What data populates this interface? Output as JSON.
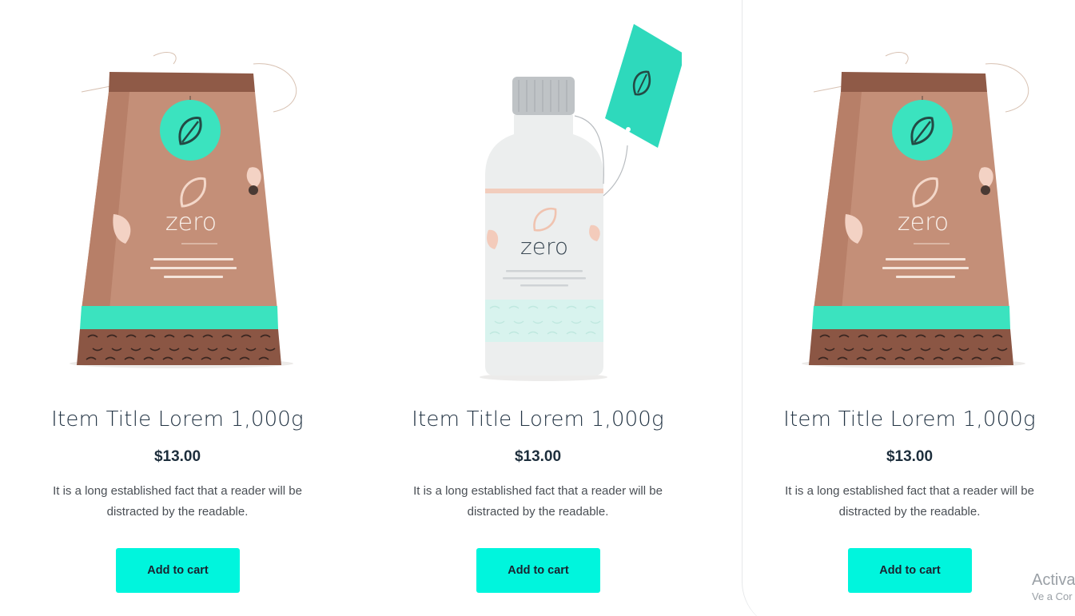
{
  "brand": {
    "accent": "#00f5dd",
    "tag_color": "#3be3bf",
    "kraft": "#c48f78"
  },
  "products": [
    {
      "image": {
        "kind": "kraft-bag",
        "label": "zero"
      },
      "title": "Item Title Lorem 1,000g",
      "price": "$13.00",
      "description": "It is a long established fact that a reader will be distracted by the readable.",
      "button_label": "Add to cart"
    },
    {
      "image": {
        "kind": "bottle",
        "label": "zero"
      },
      "title": "Item Title Lorem 1,000g",
      "price": "$13.00",
      "description": "It is a long established fact that a reader will be distracted by the readable.",
      "button_label": "Add to cart"
    },
    {
      "image": {
        "kind": "kraft-bag",
        "label": "zero"
      },
      "title": "Item Title Lorem 1,000g",
      "price": "$13.00",
      "description": "It is a long established fact that a reader will be distracted by the readable.",
      "button_label": "Add to cart"
    }
  ],
  "watermark": {
    "line1": "Activa",
    "line2": "Ve a Cor"
  }
}
